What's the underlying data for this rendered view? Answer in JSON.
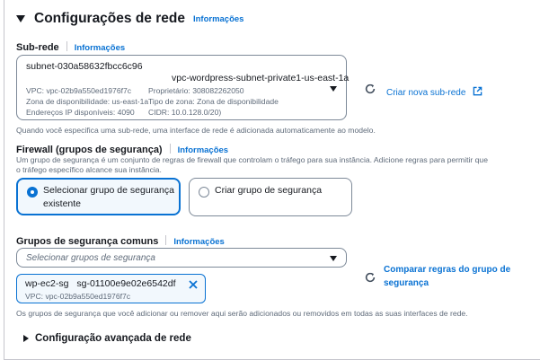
{
  "network": {
    "title": "Configurações de rede",
    "info_label": "Informações"
  },
  "subnet": {
    "label": "Sub-rede",
    "info_label": "Informações",
    "selected_id": "subnet-030a58632fbcc6c96",
    "selected_name": "vpc-wordpress-subnet-private1-us-east-1a",
    "meta_vpc": "VPC: vpc-02b9a550ed1976f7c",
    "meta_owner": "Proprietário: 308082262050",
    "meta_az": "Zona de disponibilidade: us-east-1a",
    "meta_zone_type": "Tipo de zona: Zona de disponibilidade",
    "meta_ips": "Endereços IP disponíveis: 4090",
    "meta_cidr": "CIDR: 10.0.128.0/20)",
    "create_link": "Criar nova sub-rede",
    "hint": "Quando você especifica uma sub-rede, uma interface de rede é adicionada automaticamente ao modelo."
  },
  "firewall": {
    "label": "Firewall (grupos de segurança)",
    "info_label": "Informações",
    "desc_line1": "Um grupo de segurança é um conjunto de regras de firewall que controlam o tráfego para sua instância. Adicione regras para permitir que",
    "desc_line2": "o tráfego específico alcance sua instância.",
    "option_existing": "Selecionar grupo de segurança existente",
    "option_create": "Criar grupo de segurança",
    "selected": "existing"
  },
  "common_groups": {
    "label": "Grupos de segurança comuns",
    "info_label": "Informações",
    "placeholder": "Selecionar grupos de segurança",
    "compare_link": "Comparar regras do grupo de segurança",
    "token_name": "wp-ec2-sg",
    "token_id": "sg-01100e9e02e6542df",
    "token_vpc": "VPC: vpc-02b9a550ed1976f7c",
    "hint": "Os grupos de segurança que você adicionar ou remover aqui serão adicionados ou removidos em todas as suas interfaces de rede."
  },
  "advanced": {
    "title": "Configuração avançada de rede"
  },
  "colors": {
    "link": "#0972d3",
    "text": "#16191f",
    "muted": "#5f6b7a",
    "border": "#7d8998",
    "selected_bg": "#f2f8fd"
  }
}
